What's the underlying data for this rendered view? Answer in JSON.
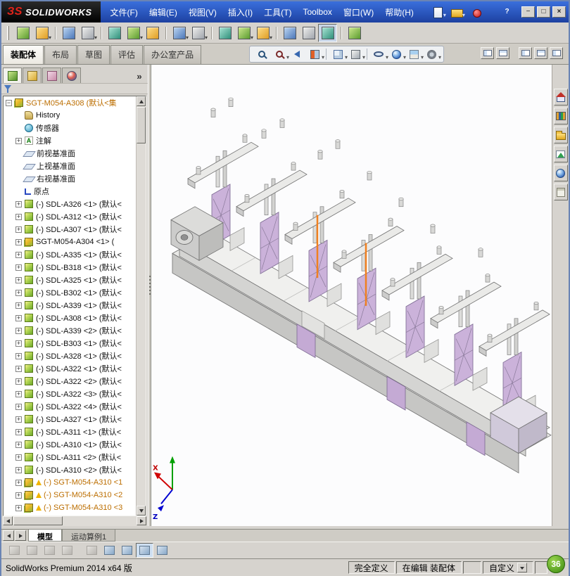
{
  "colors": {
    "titlebar_blue": "#2a56bc",
    "chrome_gray": "#d6d3ce",
    "plate_purple": "#cbb2da",
    "highlight_orange": "#f08020",
    "warning_yellow": "#f0b400",
    "badge_green": "#3a8a10"
  },
  "window": {
    "logo": {
      "prefix": "ЗS",
      "text": "SOLIDWORKS"
    },
    "menus": [
      {
        "name": "menu-file",
        "label": "文件(F)"
      },
      {
        "name": "menu-edit",
        "label": "编辑(E)"
      },
      {
        "name": "menu-view",
        "label": "视图(V)"
      },
      {
        "name": "menu-insert",
        "label": "插入(I)"
      },
      {
        "name": "menu-tools",
        "label": "工具(T)"
      },
      {
        "name": "menu-toolbox",
        "label": "Toolbox"
      },
      {
        "name": "menu-window",
        "label": "窗口(W)"
      },
      {
        "name": "menu-help",
        "label": "帮助(H)"
      }
    ],
    "quick_icons": [
      {
        "name": "new-document-button",
        "icon": "new-doc",
        "dd": true
      },
      {
        "name": "open-document-button",
        "icon": "open-doc",
        "dd": true
      },
      {
        "name": "macro-record-indicator",
        "icon": "record-dot"
      }
    ],
    "controls": [
      {
        "name": "help-button",
        "icon": "help"
      },
      {
        "name": "minimize-button",
        "icon": "minimize"
      },
      {
        "name": "maximize-button",
        "icon": "maximize"
      },
      {
        "name": "close-button",
        "icon": "close"
      }
    ]
  },
  "toolbar_main": {
    "icons": [
      {
        "name": "edit-component-button"
      },
      {
        "name": "insert-components-button",
        "dd": true
      },
      {
        "name": "mate-button",
        "gap": true
      },
      {
        "name": "linear-component-pattern-button",
        "dd": true
      },
      {
        "name": "smart-fasteners-button",
        "gap": true
      },
      {
        "name": "move-component-button",
        "dd": true
      },
      {
        "name": "show-hidden-components-button"
      },
      {
        "name": "assembly-features-button",
        "dd": true,
        "gap": true
      },
      {
        "name": "reference-geometry-button",
        "dd": true
      },
      {
        "name": "new-motion-study-button",
        "gap": true
      },
      {
        "name": "bill-of-materials-button",
        "dd": true
      },
      {
        "name": "exploded-view-button",
        "dd": true
      },
      {
        "name": "explode-line-sketch-button",
        "gap": true
      },
      {
        "name": "interference-detection-button"
      },
      {
        "name": "instant3d-button",
        "pressed": true
      },
      {
        "name": "external-references-button",
        "gap": true
      }
    ]
  },
  "command_tabs": {
    "items": [
      {
        "name": "tab-assembly",
        "label": "装配体",
        "active": true
      },
      {
        "name": "tab-layout",
        "label": "布局"
      },
      {
        "name": "tab-sketch",
        "label": "草图"
      },
      {
        "name": "tab-evaluate",
        "label": "评估"
      },
      {
        "name": "tab-office-products",
        "label": "办公室产品"
      }
    ]
  },
  "view_toolbar": {
    "icons": [
      {
        "name": "zoom-to-fit-button",
        "icon": "zoom-fit"
      },
      {
        "name": "zoom-to-area-button",
        "icon": "zoom-area",
        "dd": true
      },
      {
        "name": "previous-view-button",
        "icon": "prev-view"
      },
      {
        "name": "section-view-button",
        "icon": "section",
        "dd": true
      },
      {
        "name": "view-orientation-button",
        "icon": "orientation",
        "dd": true,
        "gap": true
      },
      {
        "name": "display-style-button",
        "icon": "display-style",
        "dd": true
      },
      {
        "name": "hide-show-items-button",
        "icon": "hide-show",
        "dd": true,
        "gap": true
      },
      {
        "name": "edit-appearance-button",
        "icon": "appearance",
        "dd": true
      },
      {
        "name": "apply-scene-button",
        "icon": "scene",
        "dd": true
      },
      {
        "name": "view-settings-button",
        "icon": "settings",
        "dd": true
      }
    ]
  },
  "tabrow_right": {
    "icons": [
      {
        "name": "viewport-layout-button",
        "icon": "pane"
      },
      {
        "name": "viewport-split-button",
        "icon": "pane2"
      },
      {
        "name": "display-pane-left-button",
        "icon": "pane",
        "gap": true
      },
      {
        "name": "display-pane-right-button",
        "icon": "pane2"
      },
      {
        "name": "fullscreen-button",
        "icon": "pane"
      }
    ]
  },
  "panel": {
    "tabs": [
      {
        "name": "featuremanager-tree-tab",
        "icon": "tree-tab",
        "active": true
      },
      {
        "name": "propertymanager-tab",
        "icon": "prop-tab"
      },
      {
        "name": "configurationmanager-tab",
        "icon": "config-tab"
      },
      {
        "name": "displaymanager-tab",
        "icon": "display-tab"
      }
    ]
  },
  "feature_tree": {
    "root": {
      "label": "SGT-M054-A308 (默认<集"
    },
    "items": [
      {
        "name": "tree-item-history",
        "icon": "history",
        "label": "History",
        "no_box": true
      },
      {
        "name": "tree-item-sensors",
        "icon": "sensor",
        "label": "传感器",
        "no_box": true
      },
      {
        "name": "tree-item-annotations",
        "icon": "annotation",
        "label": "注解"
      },
      {
        "name": "tree-item-front-plane",
        "icon": "plane",
        "label": "前视基准面",
        "no_box": true
      },
      {
        "name": "tree-item-top-plane",
        "icon": "plane",
        "label": "上视基准面",
        "no_box": true
      },
      {
        "name": "tree-item-right-plane",
        "icon": "plane",
        "label": "右视基准面",
        "no_box": true
      },
      {
        "name": "tree-item-origin",
        "icon": "origin",
        "label": "原点",
        "no_box": true
      },
      {
        "name": "tree-item-component",
        "icon": "part",
        "label": "(-) SDL-A326 <1> (默认<"
      },
      {
        "name": "tree-item-component",
        "icon": "part",
        "label": "(-) SDL-A312 <1> (默认<"
      },
      {
        "name": "tree-item-component",
        "icon": "part",
        "label": "(-) SDL-A307 <1> (默认<"
      },
      {
        "name": "tree-item-component",
        "icon": "assembly",
        "label": "SGT-M054-A304 <1> ("
      },
      {
        "name": "tree-item-component",
        "icon": "part",
        "label": "(-) SDL-A335 <1> (默认<"
      },
      {
        "name": "tree-item-component",
        "icon": "part",
        "label": "(-) SDL-B318 <1> (默认<"
      },
      {
        "name": "tree-item-component",
        "icon": "part",
        "label": "(-) SDL-A325 <1> (默认<"
      },
      {
        "name": "tree-item-component",
        "icon": "part",
        "label": "(-) SDL-B302 <1> (默认<"
      },
      {
        "name": "tree-item-component",
        "icon": "part",
        "label": "(-) SDL-A339 <1> (默认<"
      },
      {
        "name": "tree-item-component",
        "icon": "part",
        "label": "(-) SDL-A308 <1> (默认<"
      },
      {
        "name": "tree-item-component",
        "icon": "part",
        "label": "(-) SDL-A339 <2> (默认<"
      },
      {
        "name": "tree-item-component",
        "icon": "part",
        "label": "(-) SDL-B303 <1> (默认<"
      },
      {
        "name": "tree-item-component",
        "icon": "part",
        "label": "(-) SDL-A328 <1> (默认<"
      },
      {
        "name": "tree-item-component",
        "icon": "part",
        "label": "(-) SDL-A322 <1> (默认<"
      },
      {
        "name": "tree-item-component",
        "icon": "part",
        "label": "(-) SDL-A322 <2> (默认<"
      },
      {
        "name": "tree-item-component",
        "icon": "part",
        "label": "(-) SDL-A322 <3> (默认<"
      },
      {
        "name": "tree-item-component",
        "icon": "part",
        "label": "(-) SDL-A322 <4> (默认<"
      },
      {
        "name": "tree-item-component",
        "icon": "part",
        "label": "(-) SDL-A327 <1> (默认<"
      },
      {
        "name": "tree-item-component",
        "icon": "part",
        "label": "(-) SDL-A311 <1> (默认<"
      },
      {
        "name": "tree-item-component",
        "icon": "part",
        "label": "(-) SDL-A310 <1> (默认<"
      },
      {
        "name": "tree-item-component",
        "icon": "part",
        "label": "(-) SDL-A311 <2> (默认<"
      },
      {
        "name": "tree-item-component",
        "icon": "part",
        "label": "(-) SDL-A310 <2> (默认<"
      },
      {
        "name": "tree-item-component",
        "icon": "assembly",
        "warn": true,
        "orange": true,
        "label": "(-) SGT-M054-A310 <1"
      },
      {
        "name": "tree-item-component",
        "icon": "assembly",
        "warn": true,
        "orange": true,
        "label": "(-) SGT-M054-A310 <2"
      },
      {
        "name": "tree-item-component",
        "icon": "assembly",
        "warn": true,
        "orange": true,
        "label": "(-) SGT-M054-A310 <3"
      },
      {
        "name": "tree-item-component",
        "icon": "part",
        "label": ""
      }
    ]
  },
  "graphics": {
    "triad": {
      "x": "X",
      "z": "Z"
    }
  },
  "task_pane": {
    "icons": [
      {
        "name": "solidworks-resources-tab",
        "icon": "home"
      },
      {
        "name": "design-library-tab",
        "icon": "library"
      },
      {
        "name": "file-explorer-tab",
        "icon": "folder"
      },
      {
        "name": "view-palette-tab",
        "icon": "palette"
      },
      {
        "name": "appearances-scenes-tab",
        "icon": "sphere"
      },
      {
        "name": "custom-properties-tab",
        "icon": "props"
      }
    ]
  },
  "bottom_tabs": {
    "nav": [
      {
        "name": "scroll-tabs-left-button",
        "icon": "tri-left"
      },
      {
        "name": "scroll-tabs-right-button",
        "icon": "tri-right"
      }
    ],
    "items": [
      {
        "name": "model-tab",
        "label": "模型",
        "active": true
      },
      {
        "name": "motion-study-tab",
        "label": "运动算例1"
      }
    ]
  },
  "bottom_toolbar": {
    "icons": [
      {
        "name": "selection-filter-toggle-button",
        "disabled": true
      },
      {
        "name": "filter-vertices-button",
        "disabled": true
      },
      {
        "name": "filter-edges-button",
        "disabled": true
      },
      {
        "name": "filter-faces-button",
        "disabled": true
      },
      {
        "name": "quick-snaps-button",
        "disabled": true,
        "gap": true
      },
      {
        "name": "display-states-button"
      },
      {
        "name": "appearance-display-button"
      },
      {
        "name": "hide-show-display-button",
        "pressed": true
      },
      {
        "name": "section-display-button"
      }
    ]
  },
  "status_bar": {
    "product": "SolidWorks Premium 2014 x64 版",
    "fully_defined": "完全定义",
    "editing": "在编辑 装配体",
    "custom_label": "自定义",
    "badge": "36"
  }
}
